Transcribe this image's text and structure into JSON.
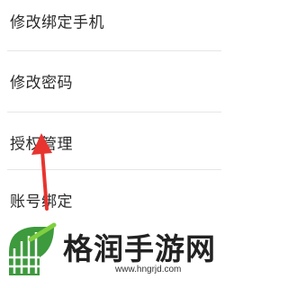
{
  "menu": {
    "items": [
      {
        "label": "修改绑定手机"
      },
      {
        "label": "修改密码"
      },
      {
        "label": "授权管理"
      },
      {
        "label": "账号绑定"
      }
    ]
  },
  "annotation": {
    "icon": "red-arrow-icon",
    "color": "#e8342f"
  },
  "watermark": {
    "title": "格润手游网",
    "url": "www.hngrjd.com",
    "logo_icon": "green-grid-logo-icon",
    "logo_color": "#3d9a3d"
  }
}
